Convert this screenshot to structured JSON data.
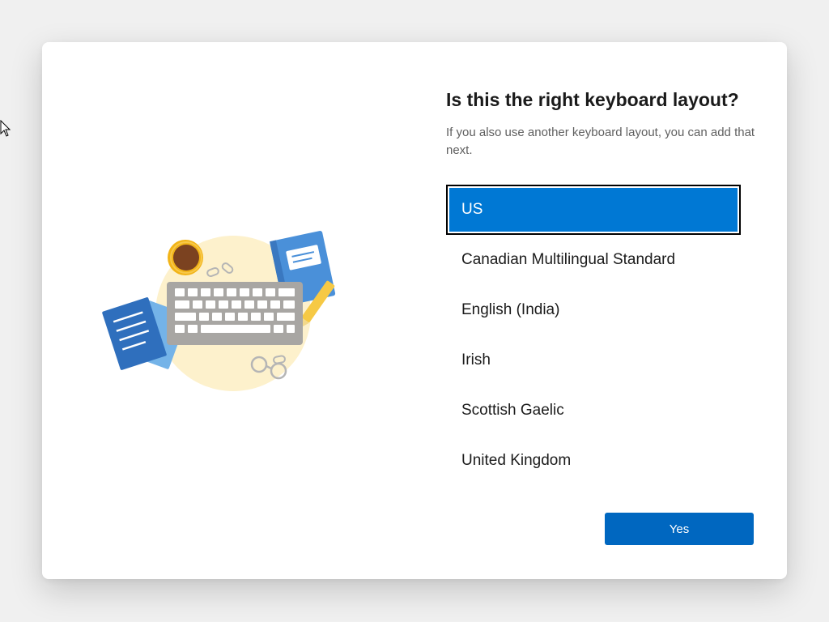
{
  "dialog": {
    "title": "Is this the right keyboard layout?",
    "subtitle": "If you also use another keyboard layout, you can add that next."
  },
  "layouts": {
    "items": [
      {
        "label": "US",
        "selected": true
      },
      {
        "label": "Canadian Multilingual Standard",
        "selected": false
      },
      {
        "label": "English (India)",
        "selected": false
      },
      {
        "label": "Irish",
        "selected": false
      },
      {
        "label": "Scottish Gaelic",
        "selected": false
      },
      {
        "label": "United Kingdom",
        "selected": false
      }
    ]
  },
  "actions": {
    "yes_label": "Yes"
  },
  "colors": {
    "accent": "#0078d4",
    "button": "#0067c0",
    "page_background": "#f0f0f0",
    "card_background": "#ffffff"
  },
  "icons": {
    "illustration": "keyboard-desk-illustration",
    "cursor": "mouse-pointer-icon"
  }
}
